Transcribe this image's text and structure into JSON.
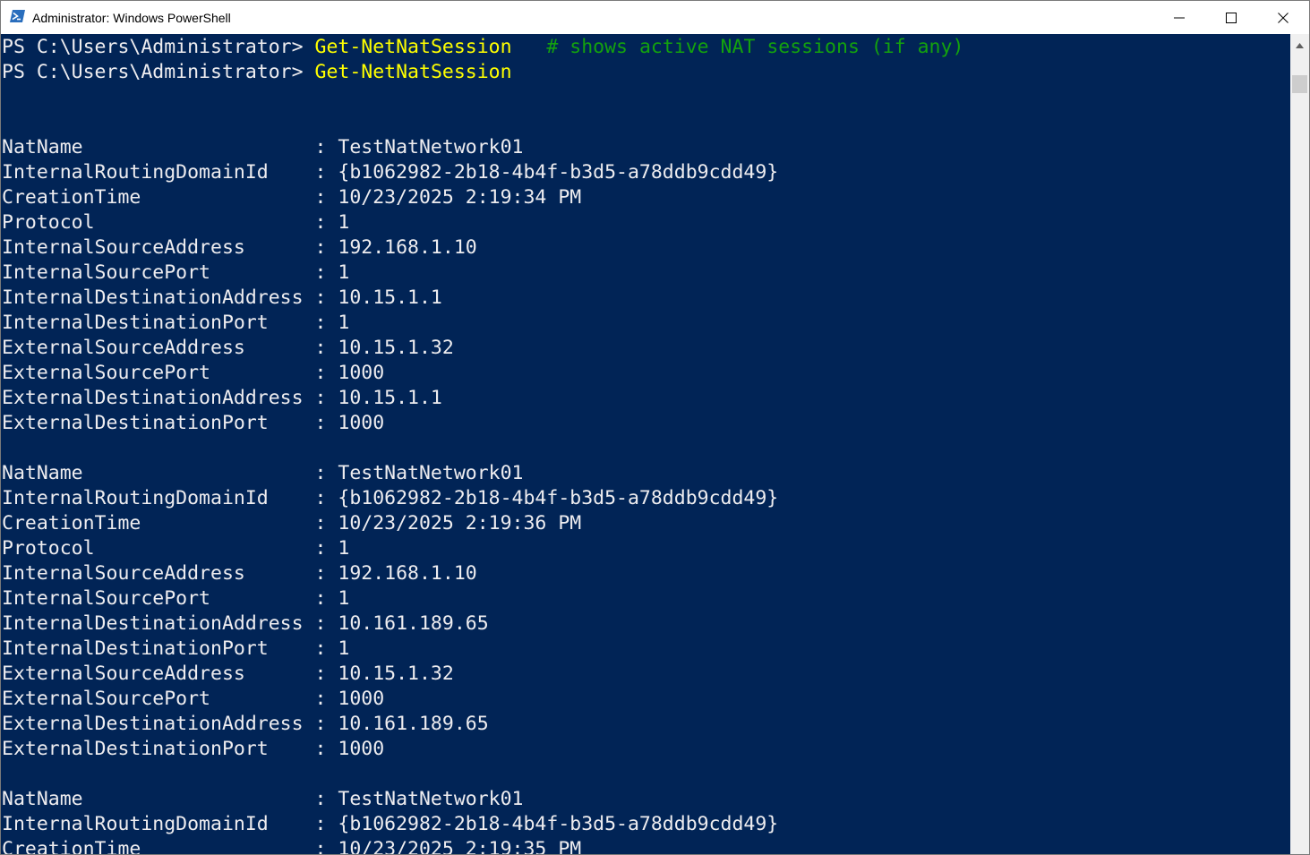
{
  "window": {
    "title": "Administrator: Windows PowerShell"
  },
  "icons": {
    "app": "powershell-icon",
    "minimize": "minimize-icon",
    "maximize": "maximize-icon",
    "close": "close-icon",
    "scroll_up": "scroll-up-arrow-icon"
  },
  "colors": {
    "console_bg": "#012456",
    "console_fg": "#eeedf0",
    "command": "#ffff00",
    "comment": "#13a10e"
  },
  "console": {
    "prompts": [
      {
        "prompt": "PS C:\\Users\\Administrator> ",
        "command": "Get-NetNatSession",
        "comment": "   # shows active NAT sessions (if any)"
      },
      {
        "prompt": "PS C:\\Users\\Administrator> ",
        "command": "Get-NetNatSession",
        "comment": ""
      }
    ],
    "records": [
      [
        {
          "key": "NatName",
          "value": "TestNatNetwork01"
        },
        {
          "key": "InternalRoutingDomainId",
          "value": "{b1062982-2b18-4b4f-b3d5-a78ddb9cdd49}"
        },
        {
          "key": "CreationTime",
          "value": "10/23/2025 2:19:34 PM"
        },
        {
          "key": "Protocol",
          "value": "1"
        },
        {
          "key": "InternalSourceAddress",
          "value": "192.168.1.10"
        },
        {
          "key": "InternalSourcePort",
          "value": "1"
        },
        {
          "key": "InternalDestinationAddress",
          "value": "10.15.1.1"
        },
        {
          "key": "InternalDestinationPort",
          "value": "1"
        },
        {
          "key": "ExternalSourceAddress",
          "value": "10.15.1.32"
        },
        {
          "key": "ExternalSourcePort",
          "value": "1000"
        },
        {
          "key": "ExternalDestinationAddress",
          "value": "10.15.1.1"
        },
        {
          "key": "ExternalDestinationPort",
          "value": "1000"
        }
      ],
      [
        {
          "key": "NatName",
          "value": "TestNatNetwork01"
        },
        {
          "key": "InternalRoutingDomainId",
          "value": "{b1062982-2b18-4b4f-b3d5-a78ddb9cdd49}"
        },
        {
          "key": "CreationTime",
          "value": "10/23/2025 2:19:36 PM"
        },
        {
          "key": "Protocol",
          "value": "1"
        },
        {
          "key": "InternalSourceAddress",
          "value": "192.168.1.10"
        },
        {
          "key": "InternalSourcePort",
          "value": "1"
        },
        {
          "key": "InternalDestinationAddress",
          "value": "10.161.189.65"
        },
        {
          "key": "InternalDestinationPort",
          "value": "1"
        },
        {
          "key": "ExternalSourceAddress",
          "value": "10.15.1.32"
        },
        {
          "key": "ExternalSourcePort",
          "value": "1000"
        },
        {
          "key": "ExternalDestinationAddress",
          "value": "10.161.189.65"
        },
        {
          "key": "ExternalDestinationPort",
          "value": "1000"
        }
      ],
      [
        {
          "key": "NatName",
          "value": "TestNatNetwork01"
        },
        {
          "key": "InternalRoutingDomainId",
          "value": "{b1062982-2b18-4b4f-b3d5-a78ddb9cdd49}"
        },
        {
          "key": "CreationTime",
          "value": "10/23/2025 2:19:35 PM"
        }
      ]
    ]
  }
}
